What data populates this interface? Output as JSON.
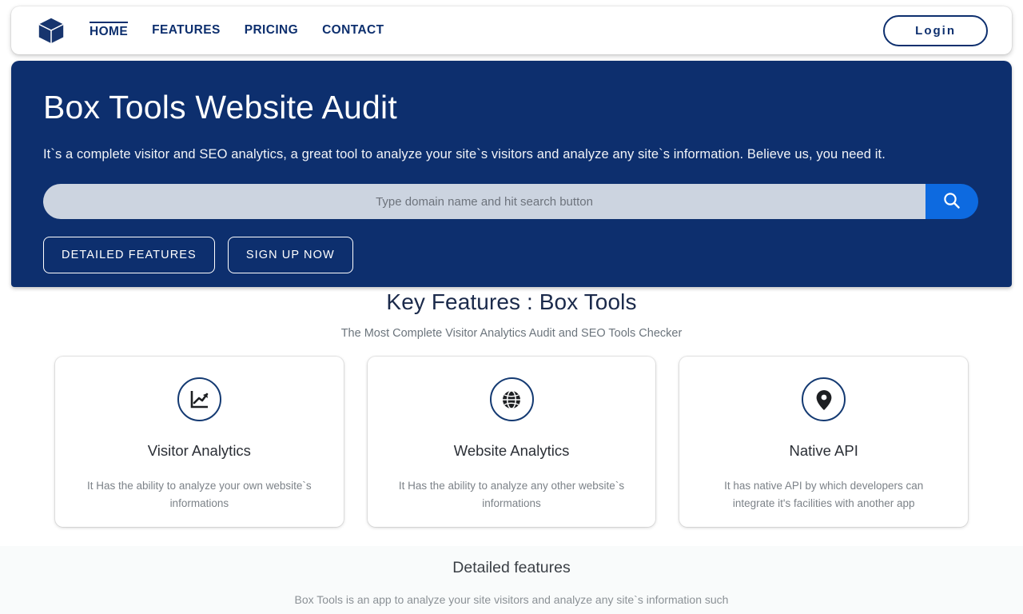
{
  "nav": {
    "logo_icon": "box-cube-icon",
    "links": [
      {
        "label": "HOME",
        "active": true
      },
      {
        "label": "FEATURES",
        "active": false
      },
      {
        "label": "PRICING",
        "active": false
      },
      {
        "label": "CONTACT",
        "active": false
      }
    ],
    "login_label": "Login"
  },
  "hero": {
    "title": "Box Tools Website Audit",
    "subtitle": "It`s a complete visitor and SEO analytics, a great tool to analyze your site`s visitors and analyze any site`s information. Believe us, you need it.",
    "search": {
      "value": "",
      "placeholder": "Type domain name and hit search button",
      "button_icon": "search-icon"
    },
    "buttons": [
      {
        "label": "DETAILED FEATURES"
      },
      {
        "label": "SIGN UP NOW"
      }
    ],
    "bg_color": "#0d2f6e",
    "search_button_color": "#0d6ae0"
  },
  "features": {
    "title": "Key Features : Box Tools",
    "subtitle": "The Most Complete Visitor Analytics Audit and SEO Tools Checker",
    "cards": [
      {
        "icon": "line-chart-icon",
        "title": "Visitor Analytics",
        "description": "It Has the ability to analyze your own website`s informations"
      },
      {
        "icon": "globe-icon",
        "title": "Website Analytics",
        "description": "It Has the ability to analyze any other website`s informations"
      },
      {
        "icon": "map-pin-icon",
        "title": "Native API",
        "description": "It has native API by which developers can integrate it's facilities with another app"
      }
    ]
  },
  "detailed": {
    "title": "Detailed features",
    "text": "Box Tools is an app to analyze your site visitors and analyze any site`s information such"
  }
}
